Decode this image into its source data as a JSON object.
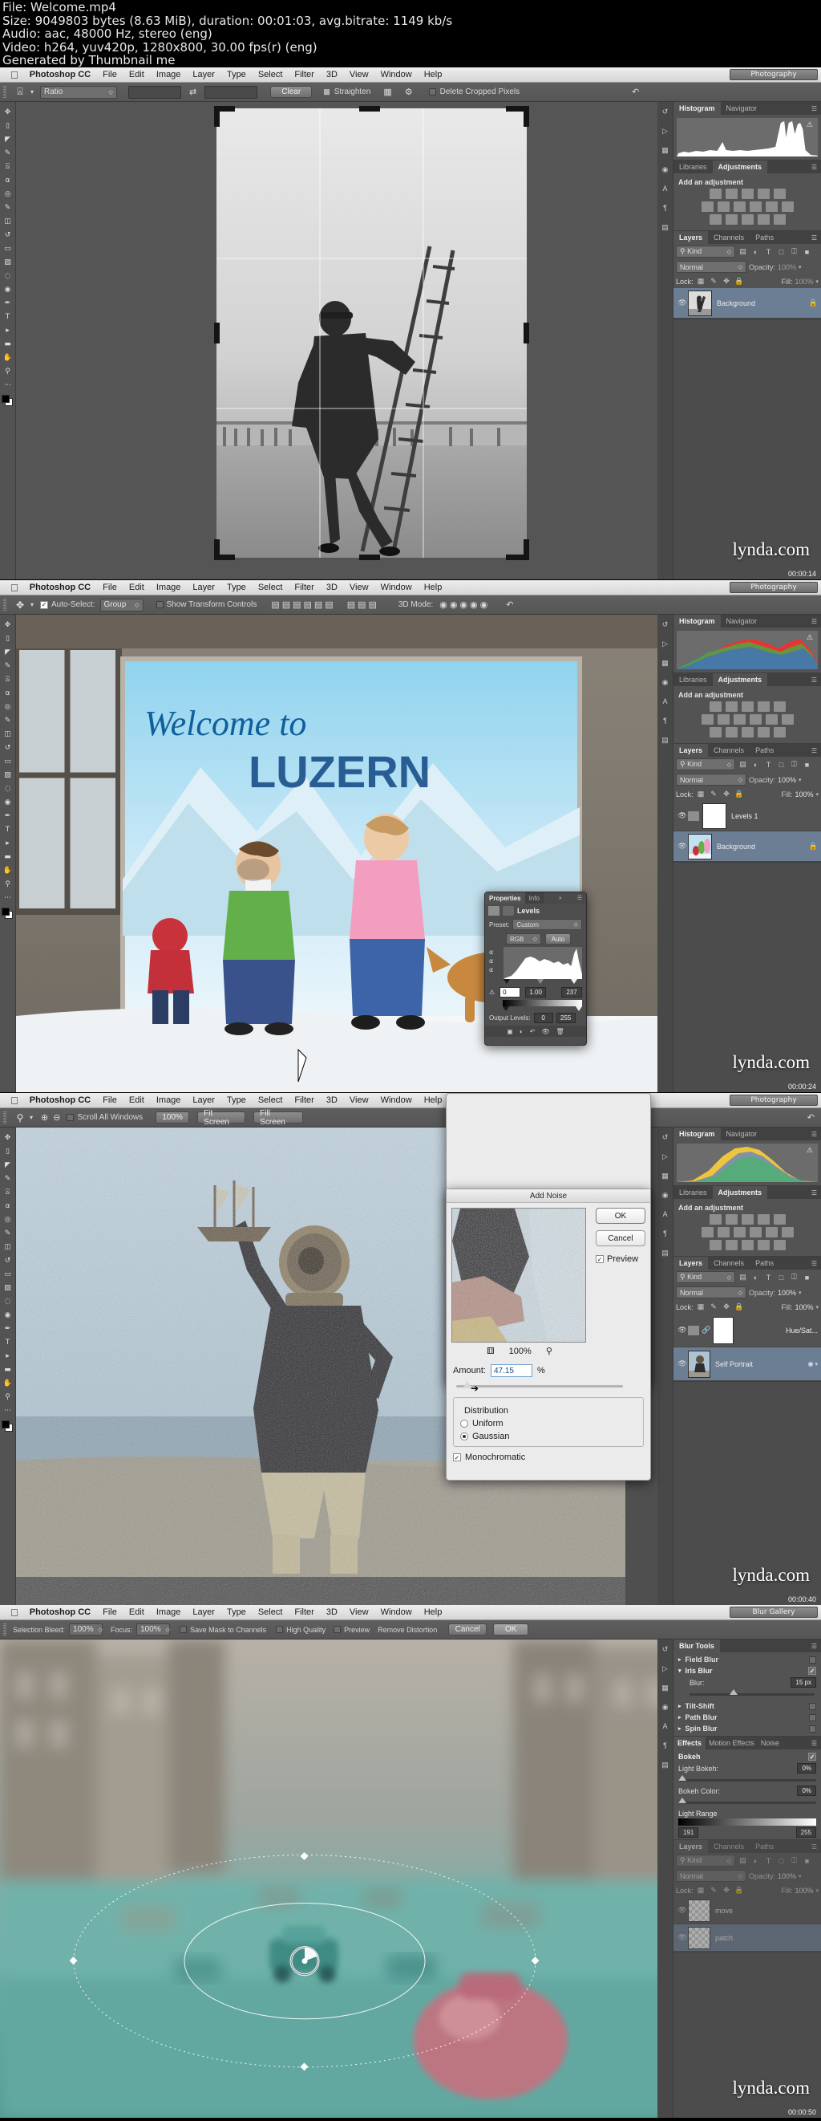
{
  "video_info": {
    "line1": "File: Welcome.mp4",
    "line2": "Size: 9049803 bytes (8.63 MiB), duration: 00:01:03, avg.bitrate: 1149 kb/s",
    "line3": "Audio: aac, 48000 Hz, stereo (eng)",
    "line4": "Video: h264, yuv420p, 1280x800, 30.00 fps(r) (eng)",
    "line5": "Generated by Thumbnail me"
  },
  "menubar": {
    "apple": "apple-logo",
    "app": "Photoshop CC",
    "items": [
      "File",
      "Edit",
      "Image",
      "Layer",
      "Type",
      "Select",
      "Filter",
      "3D",
      "View",
      "Window",
      "Help"
    ],
    "right_icons": [
      "wifi-icon",
      "search-icon",
      "list-icon"
    ]
  },
  "watermark": "lynda.com",
  "frames": [
    {
      "timestamp": "00:00:14",
      "workspace": "Photography",
      "options_bar": {
        "tool_icon": "crop-tool-icon",
        "ratio_label": "Ratio",
        "width_value": "",
        "height_value": "",
        "swap_icon": "swap-arrows-icon",
        "clear_label": "Clear",
        "straighten_icon": "straighten-icon",
        "straighten_label": "Straighten",
        "grid_icon": "overlay-grid-icon",
        "gear_icon": "gear-icon",
        "delete_checkbox": false,
        "delete_label": "Delete Cropped Pixels",
        "reset_icon": "reset-icon"
      },
      "panels": {
        "top_tabs": [
          "Histogram",
          "Navigator"
        ],
        "top_active": "Histogram",
        "mid_tabs": [
          "Libraries",
          "Adjustments"
        ],
        "mid_active": "Adjustments",
        "adjust_title": "Add an adjustment",
        "layers_tabs": [
          "Layers",
          "Channels",
          "Paths"
        ],
        "layers_active": "Layers",
        "filter_kind": "Kind",
        "blend_mode": "Normal",
        "opacity_label": "Opacity:",
        "opacity_value": "100%",
        "lock_label": "Lock:",
        "fill_label": "Fill:",
        "fill_value": "100%",
        "layers": [
          {
            "name": "Background",
            "visible": true,
            "locked": true,
            "selected": true
          }
        ]
      },
      "canvas": {
        "mode": "crop-overlay",
        "description": "black-and-white photo of man on ladder at beach"
      }
    },
    {
      "timestamp": "00:00:24",
      "workspace": "Photography",
      "options_bar": {
        "tool_icon": "move-tool-icon",
        "auto_select_checkbox": true,
        "auto_select_label": "Auto-Select:",
        "group_label": "Group",
        "transform_checkbox": false,
        "transform_label": "Show Transform Controls",
        "align_icons": "align-distribute-icons",
        "mode3d_label": "3D Mode:"
      },
      "dialog": {
        "name": "properties-levels-panel",
        "tabs": [
          "Properties",
          "Info"
        ],
        "active_tab": "Properties",
        "title": "Levels",
        "preset_label": "Preset:",
        "preset_value": "Custom",
        "channel_value": "RGB",
        "auto_label": "Auto",
        "input_black": "0",
        "input_gamma": "1.00",
        "input_white": "237",
        "output_label": "Output Levels:",
        "output_black": "0",
        "output_white": "255"
      },
      "panels": {
        "top_tabs": [
          "Histogram",
          "Navigator"
        ],
        "top_active": "Histogram",
        "mid_tabs": [
          "Libraries",
          "Adjustments"
        ],
        "mid_active": "Adjustments",
        "adjust_title": "Add an adjustment",
        "layers_tabs": [
          "Layers",
          "Channels",
          "Paths"
        ],
        "layers_active": "Layers",
        "filter_kind": "Kind",
        "blend_mode": "Normal",
        "opacity_label": "Opacity:",
        "opacity_value": "100%",
        "lock_label": "Lock:",
        "fill_label": "Fill:",
        "fill_value": "100%",
        "layers": [
          {
            "name": "Levels 1",
            "visible": true,
            "locked": false,
            "selected": true
          },
          {
            "name": "Background",
            "visible": true,
            "locked": true,
            "selected": false
          }
        ]
      },
      "canvas": {
        "mode": "photo",
        "description": "kids in snow in front of painted Welcome to mural with dog"
      }
    },
    {
      "timestamp": "00:00:40",
      "workspace": "Photography",
      "options_bar": {
        "tool_icon": "zoom-tool-icon",
        "scroll_checkbox": false,
        "scroll_label": "Scroll All Windows",
        "zoom_100": "100%",
        "fit_screen": "Fit Screen",
        "fill_screen": "Fill Screen"
      },
      "dialog": {
        "name": "add-noise-dialog",
        "title": "Add Noise",
        "ok_label": "OK",
        "cancel_label": "Cancel",
        "preview_label": "Preview",
        "preview_checked": true,
        "zoom_out_icon": "zoom-out-icon",
        "zoom_level": "100%",
        "zoom_in_icon": "zoom-in-icon",
        "amount_label": "Amount:",
        "amount_value": "47.15",
        "amount_unit": "%",
        "distribution_label": "Distribution",
        "uniform_label": "Uniform",
        "gaussian_label": "Gaussian",
        "distribution_selected": "Gaussian",
        "monochromatic_label": "Monochromatic",
        "monochromatic_checked": true
      },
      "panels": {
        "top_tabs": [
          "Histogram",
          "Navigator"
        ],
        "top_active": "Histogram",
        "mid_tabs": [
          "Libraries",
          "Adjustments"
        ],
        "mid_active": "Adjustments",
        "adjust_title": "Add an adjustment",
        "layers_tabs": [
          "Layers",
          "Channels",
          "Paths"
        ],
        "layers_active": "Layers",
        "filter_kind": "Kind",
        "blend_mode": "Normal",
        "opacity_label": "Opacity:",
        "opacity_value": "100%",
        "lock_label": "Lock:",
        "fill_label": "Fill:",
        "fill_value": "100%",
        "layers": [
          {
            "name": "Hue/Sat...",
            "visible": true,
            "locked": false,
            "selected": false
          },
          {
            "name": "Self Portrait",
            "visible": true,
            "locked": false,
            "selected": true
          }
        ]
      },
      "canvas": {
        "mode": "photo",
        "description": "person in antique diving helmet holding model ship, heavy noise"
      }
    },
    {
      "timestamp": "00:00:50",
      "workspace": "Blur Gallery",
      "options_bar": {
        "selection_bleed_label": "Selection Bleed:",
        "selection_bleed_value": "100%",
        "focus_label": "Focus:",
        "focus_value": "100%",
        "save_mask_label": "Save Mask to Channels",
        "high_quality_label": "High Quality",
        "preview_label": "Preview",
        "remove_distortion": "Remove Distortion",
        "cancel_label": "Cancel",
        "ok_label": "OK"
      },
      "blur_tools": {
        "panel_title": "Blur Tools",
        "items": [
          {
            "label": "Field Blur",
            "enabled": false,
            "expanded": false
          },
          {
            "label": "Iris Blur",
            "enabled": true,
            "expanded": true
          },
          {
            "label": "Tilt-Shift",
            "enabled": false,
            "expanded": false
          },
          {
            "label": "Path Blur",
            "enabled": false,
            "expanded": false
          },
          {
            "label": "Spin Blur",
            "enabled": false,
            "expanded": false
          }
        ],
        "blur_label": "Blur:",
        "blur_value": "15 px"
      },
      "effects": {
        "tabs": [
          "Effects",
          "Motion Effects",
          "Noise"
        ],
        "active_tab": "Effects",
        "bokeh_label": "Bokeh",
        "light_bokeh_label": "Light Bokeh:",
        "light_bokeh_value": "0%",
        "bokeh_color_label": "Bokeh Color:",
        "bokeh_color_value": "0%",
        "light_range_label": "Light Range",
        "range_min": "191",
        "range_max": "255"
      },
      "panels": {
        "top_tabs": [
          "Histogram",
          "Navigator"
        ],
        "top_active": "Histogram",
        "mid_tabs": [
          "Libraries",
          "Adjustments"
        ],
        "mid_active": "Adjustments",
        "adjust_title": "Add an adjustment",
        "layers_tabs": [
          "Layers",
          "Channels",
          "Paths"
        ],
        "layers_active": "Layers",
        "filter_kind": "Kind",
        "blend_mode": "Normal",
        "opacity_label": "Opacity:",
        "opacity_value": "100%",
        "lock_label": "Lock:",
        "fill_label": "Fill:",
        "fill_value": "100%",
        "layers": [
          {
            "name": "move",
            "visible": true,
            "locked": false,
            "selected": false
          },
          {
            "name": "patch",
            "visible": true,
            "locked": false,
            "selected": true
          }
        ]
      },
      "canvas": {
        "mode": "blur-gallery",
        "description": "teal-tinted street scene with iris blur pin and pink glass vase"
      }
    }
  ],
  "colors": {
    "panel_bg": "#535353",
    "panel_dark": "#414141",
    "selection_blue": "#6c7e94",
    "accent_teal": "#5fb6ad",
    "accent_pink": "#c06070"
  }
}
